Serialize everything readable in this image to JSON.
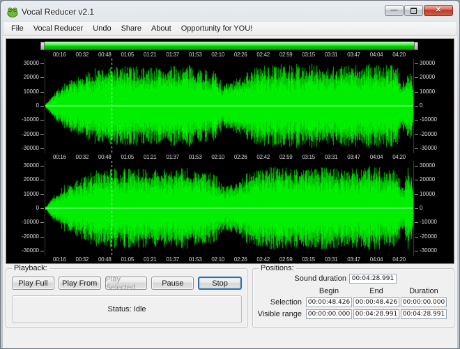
{
  "window": {
    "title": "Vocal Reducer v2.1"
  },
  "menu": {
    "items": [
      "File",
      "Vocal Reducer",
      "Undo",
      "Share",
      "About",
      "Opportunity for YOU!"
    ]
  },
  "waveform": {
    "time_labels": [
      "00:16",
      "00:32",
      "00:48",
      "01:05",
      "01:21",
      "01:37",
      "01:53",
      "02:10",
      "02:26",
      "02:42",
      "02:59",
      "03:15",
      "03:31",
      "03:47",
      "04:04",
      "04:20"
    ],
    "amplitude_labels": [
      "30000",
      "20000",
      "10000",
      "0",
      "-10000",
      "-20000",
      "-30000"
    ],
    "cursor_ratio": 0.18,
    "wave_color": "#00e400",
    "background_color": "#000000"
  },
  "playback": {
    "group_label": "Playback:",
    "buttons": [
      {
        "label": "Play Full",
        "enabled": true
      },
      {
        "label": "Play From",
        "enabled": true
      },
      {
        "label": "Play Selected",
        "enabled": false
      },
      {
        "label": "Pause",
        "enabled": true
      },
      {
        "label": "Stop",
        "enabled": true,
        "focused": true
      }
    ],
    "status": "Status: Idle"
  },
  "positions": {
    "group_label": "Positions:",
    "sound_duration_label": "Sound duration",
    "sound_duration": "00:04:28.991",
    "col_headers": [
      "Begin",
      "End",
      "Duration"
    ],
    "rows": [
      {
        "label": "Selection",
        "begin": "00:00:48.426",
        "end": "00:00:48.426",
        "duration": "00:00:00.000"
      },
      {
        "label": "Visible range",
        "begin": "00:00:00.000",
        "end": "00:04:28.991",
        "duration": "00:04:28.991"
      }
    ]
  }
}
